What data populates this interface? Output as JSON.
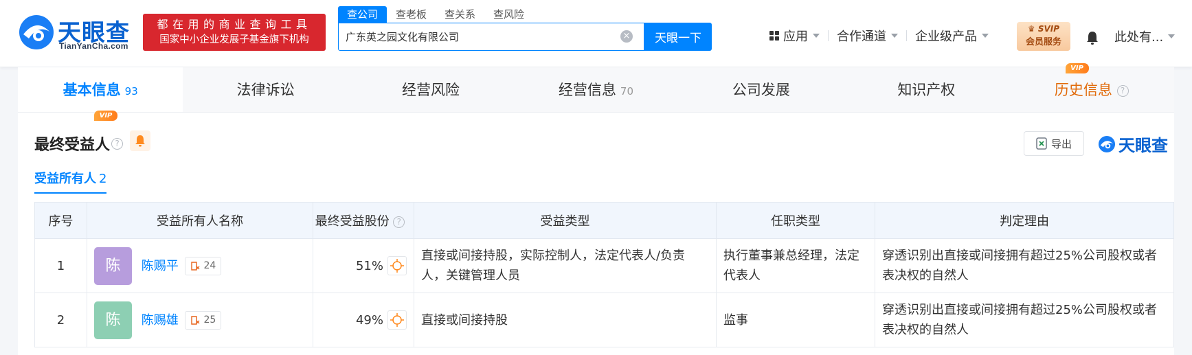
{
  "header": {
    "logo_text": "天眼查",
    "logo_sub": "TianYanCha.com",
    "slogan_line1": "都在用的商业查询工具",
    "slogan_line2": "国家中小企业发展子基金旗下机构",
    "search_tabs": [
      "查公司",
      "查老板",
      "查关系",
      "查风险"
    ],
    "search_value": "广东英之园文化有限公司",
    "search_button": "天眼一下",
    "nav": [
      "应用",
      "合作通道",
      "企业级产品"
    ],
    "svip_top": "SVIP",
    "svip_bottom": "会员服务",
    "user": "此处有..."
  },
  "tabs": [
    {
      "label": "基本信息",
      "count": "93"
    },
    {
      "label": "法律诉讼",
      "count": ""
    },
    {
      "label": "经营风险",
      "count": ""
    },
    {
      "label": "经营信息",
      "count": "70"
    },
    {
      "label": "公司发展",
      "count": ""
    },
    {
      "label": "知识产权",
      "count": ""
    },
    {
      "label": "历史信息",
      "count": ""
    }
  ],
  "vip_label": "VIP",
  "section": {
    "title": "最终受益人",
    "export_label": "导出",
    "mini_logo": "天眼查",
    "subtab_label": "受益所有人",
    "subtab_count": "2"
  },
  "table": {
    "headers": [
      "序号",
      "受益所有人名称",
      "最终受益股份",
      "受益类型",
      "任职类型",
      "判定理由"
    ],
    "rows": [
      {
        "idx": "1",
        "avatar": "陈",
        "avatar_color": "#b79ddd",
        "name": "陈赐平",
        "cases": "24",
        "share": "51%",
        "type": "直接或间接持股，实际控制人，法定代表人/负责人，关键管理人员",
        "role": "执行董事兼总经理，法定代表人",
        "reason": "穿透识别出直接或间接拥有超过25%公司股权或者表决权的自然人"
      },
      {
        "idx": "2",
        "avatar": "陈",
        "avatar_color": "#8dcfb3",
        "name": "陈赐雄",
        "cases": "25",
        "share": "49%",
        "type": "直接或间接持股",
        "role": "监事",
        "reason": "穿透识别出直接或间接拥有超过25%公司股权或者表决权的自然人"
      }
    ]
  },
  "colors": {
    "primary": "#0084ff",
    "brand": "#0a62d0",
    "slogan_bg": "#d8272e",
    "history": "#e16b0b"
  }
}
